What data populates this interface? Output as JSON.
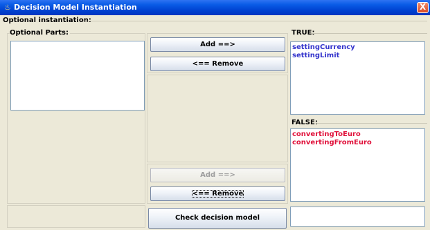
{
  "window": {
    "title": "Decision Model Instantiation",
    "close_label": "X"
  },
  "optional_instantiation": {
    "label": "Optional instantiation:"
  },
  "optional_parts": {
    "label": "Optional Parts:",
    "items": []
  },
  "true_group": {
    "label": "TRUE:",
    "color": "#3333cc",
    "items": [
      "settingCurrency",
      "settingLimit"
    ]
  },
  "false_group": {
    "label": "FALSE:",
    "color": "#e0103a",
    "items": [
      "convertingToEuro",
      "convertingFromEuro"
    ]
  },
  "upper_buttons": {
    "add": "Add ==>",
    "remove": "<== Remove"
  },
  "lower_buttons": {
    "add": "Add ==>",
    "remove": "<== Remove",
    "add_enabled": false
  },
  "footer": {
    "check_button": "Check decision model",
    "result_text": ""
  }
}
